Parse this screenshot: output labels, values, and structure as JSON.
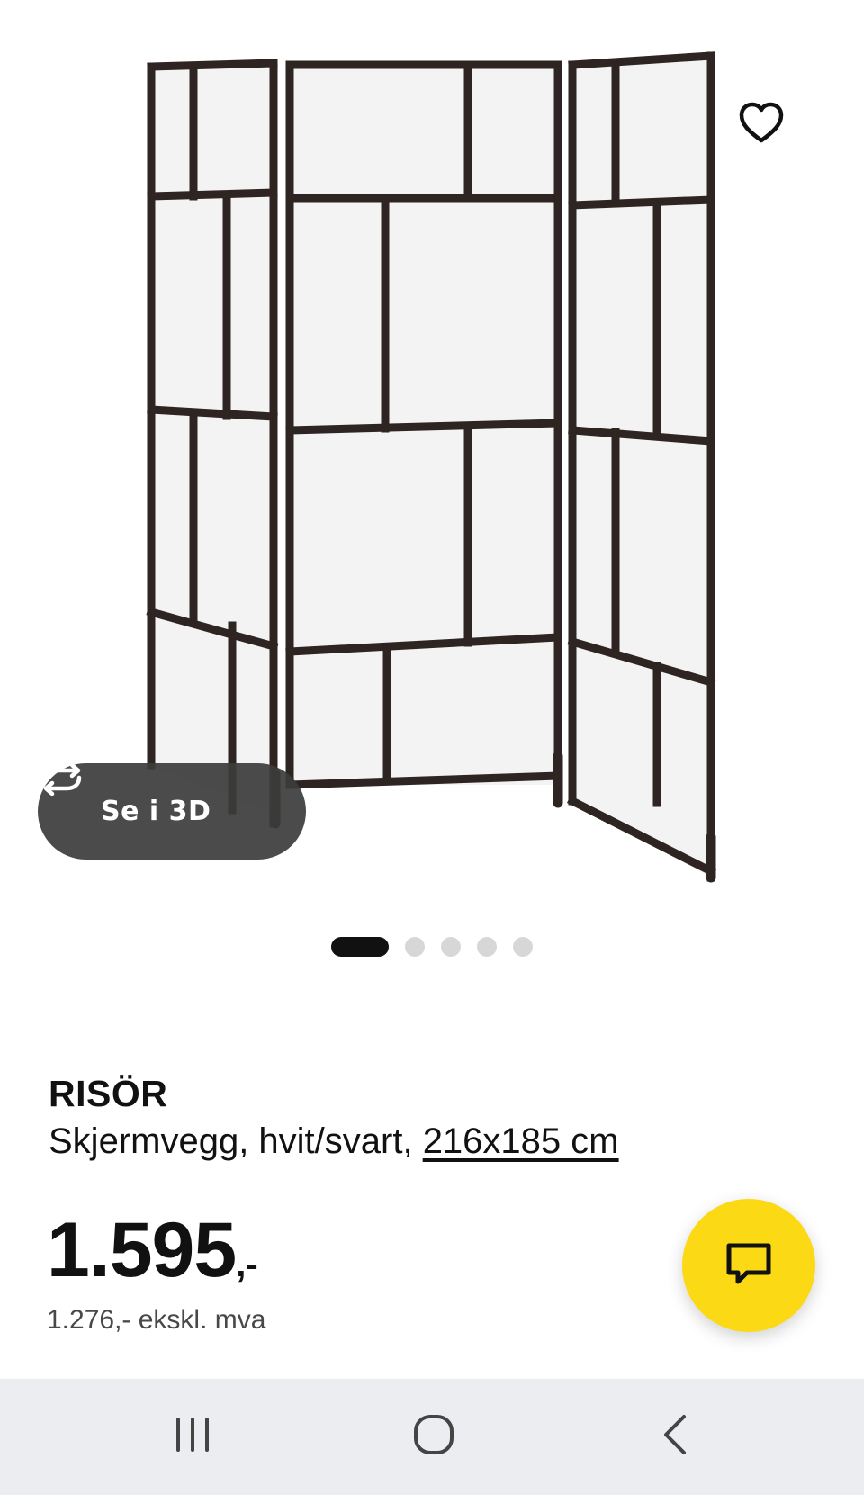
{
  "product": {
    "brand": "RISÖR",
    "description_prefix": "Skjermvegg, hvit/svart, ",
    "size_link": "216x185 cm",
    "price_main": "1.595",
    "price_suffix": ",-",
    "price_ex_vat": "1.276,- ekskl. mva"
  },
  "gallery": {
    "view_3d_label": "Se i 3D",
    "slide_count": 5,
    "active_slide": 1
  },
  "icons": {
    "favorite": "heart-outline-icon",
    "view_3d": "rotate-arrows-icon",
    "chat": "chat-bubble-icon",
    "nav_recents": "recents-icon",
    "nav_home": "home-icon",
    "nav_back": "back-icon"
  },
  "colors": {
    "accent_yellow": "#fbd914",
    "frame_brown": "#2e2522",
    "nav_bar": "#ecedf1",
    "pill_3d": "#3c3c3c"
  }
}
